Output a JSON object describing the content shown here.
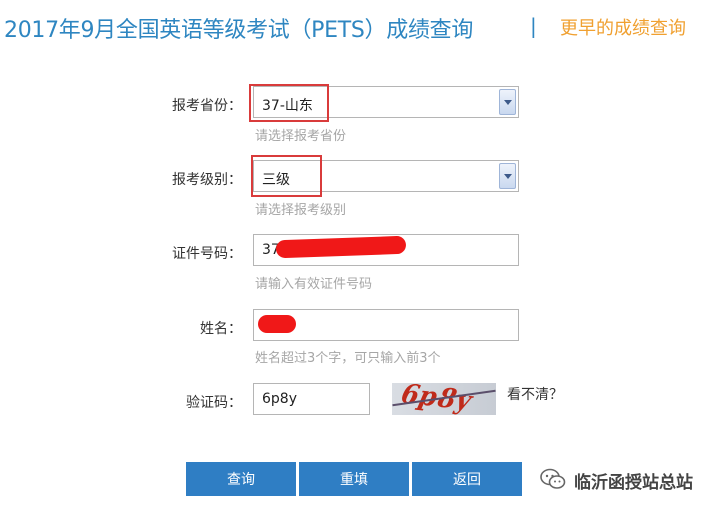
{
  "header": {
    "title": "2017年9月全国英语等级考试（PETS）成绩查询",
    "separator": "|",
    "earlier_link": "更早的成绩查询"
  },
  "form": {
    "province": {
      "label": "报考省份：",
      "value": "37-山东",
      "hint": "请选择报考省份"
    },
    "level": {
      "label": "报考级别：",
      "value": "三级",
      "hint": "请选择报考级别"
    },
    "id_number": {
      "label": "证件号码：",
      "value": "37",
      "hint": "请输入有效证件号码"
    },
    "name": {
      "label": "姓名：",
      "value": "",
      "hint": "姓名超过3个字，可只输入前3个"
    },
    "captcha": {
      "label": "验证码：",
      "value": "6p8y",
      "image_text": "6p8y",
      "refresh_link": "看不清？"
    }
  },
  "buttons": {
    "query": "查询",
    "reset": "重填",
    "back": "返回"
  },
  "watermark": {
    "account": "临沂函授站总站"
  },
  "colors": {
    "title_blue": "#2e86c1",
    "link_orange": "#f0a030",
    "button_blue": "#2f7ec4",
    "annotation_red": "#d93b3b"
  }
}
